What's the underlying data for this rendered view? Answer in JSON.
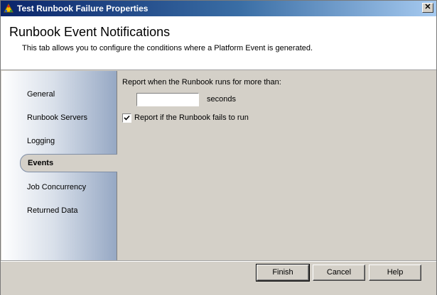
{
  "window": {
    "title": "Test Runbook Failure Properties",
    "close_glyph": "✕"
  },
  "header": {
    "title": "Runbook Event Notifications",
    "subtitle": "This tab allows you to configure the conditions where a Platform Event is generated."
  },
  "sidebar": {
    "items": [
      {
        "label": "General",
        "selected": false
      },
      {
        "label": "Runbook Servers",
        "selected": false
      },
      {
        "label": "Logging",
        "selected": false
      },
      {
        "label": "Events",
        "selected": true
      },
      {
        "label": "Job Concurrency",
        "selected": false
      },
      {
        "label": "Returned Data",
        "selected": false
      }
    ]
  },
  "content": {
    "report_duration_label": "Report when the Runbook runs for more than:",
    "seconds_value": "",
    "seconds_unit": "seconds",
    "fail_checkbox_label": "Report if the Runbook fails to run",
    "fail_checkbox_checked": true
  },
  "footer": {
    "finish_label": "Finish",
    "cancel_label": "Cancel",
    "help_label": "Help"
  },
  "colors": {
    "titlebar_start": "#0a246a",
    "titlebar_end": "#a6caf0",
    "dialog_face": "#d4d0c8"
  }
}
